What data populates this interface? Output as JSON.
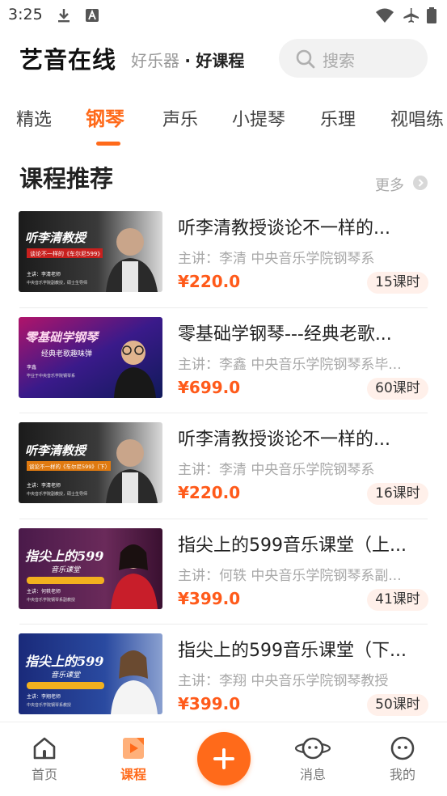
{
  "status_bar": {
    "time": "3:25"
  },
  "header": {
    "title": "艺音在线",
    "slogan_part1": "好乐器",
    "slogan_sep": "·",
    "slogan_part2": "好课程",
    "search_placeholder": "搜索"
  },
  "tabs": [
    {
      "label": "精选",
      "active": false
    },
    {
      "label": "钢琴",
      "active": true
    },
    {
      "label": "声乐",
      "active": false
    },
    {
      "label": "小提琴",
      "active": false
    },
    {
      "label": "乐理",
      "active": false
    },
    {
      "label": "视唱练",
      "active": false
    }
  ],
  "section": {
    "title": "课程推荐",
    "more_label": "更多"
  },
  "courses": [
    {
      "title": "听李清教授谈论不一样的...",
      "teacher": "主讲：李清 中央音乐学院钢琴系",
      "price": "¥220.0",
      "lessons": "15课时",
      "cover": {
        "headline": "听李清教授",
        "sub": "谈论不一样的《车尔尼599》",
        "name": "主讲：李清老师",
        "desc": "中央音乐学院副教授，硕士生导师"
      }
    },
    {
      "title": "零基础学钢琴---经典老歌...",
      "teacher": "主讲：李鑫 中央音乐学院钢琴系毕...",
      "price": "¥699.0",
      "lessons": "60课时",
      "cover": {
        "headline": "零基础学钢琴",
        "sub": "经典老歌趣味弹",
        "name": "李鑫",
        "desc": "毕业于中央音乐学院钢琴系"
      }
    },
    {
      "title": "听李清教授谈论不一样的...",
      "teacher": "主讲：李清 中央音乐学院钢琴系",
      "price": "¥220.0",
      "lessons": "16课时",
      "cover": {
        "headline": "听李清教授",
        "sub": "谈论不一样的《车尔尼599》（下）",
        "name": "主讲：李清老师",
        "desc": "中央音乐学院副教授，硕士生导师"
      }
    },
    {
      "title": "指尖上的599音乐课堂（上...",
      "teacher": "主讲：何轶 中央音乐学院钢琴系副...",
      "price": "¥399.0",
      "lessons": "41课时",
      "cover": {
        "headline": "指尖上的599",
        "sub": "音乐课堂",
        "name": "主讲：何轶老师",
        "desc": "中央音乐学院钢琴系副教授"
      }
    },
    {
      "title": "指尖上的599音乐课堂（下...",
      "teacher": "主讲：李翔 中央音乐学院钢琴教授",
      "price": "¥399.0",
      "lessons": "50课时",
      "cover": {
        "headline": "指尖上的599",
        "sub": "音乐课堂",
        "name": "主讲：李翔老师",
        "desc": "中央音乐学院钢琴系教授"
      }
    }
  ],
  "bottom_nav": [
    {
      "label": "首页",
      "icon": "home-icon",
      "active": false
    },
    {
      "label": "课程",
      "icon": "course-icon",
      "active": true
    },
    {
      "label": "",
      "icon": "plus-icon",
      "active": false
    },
    {
      "label": "消息",
      "icon": "message-icon",
      "active": false
    },
    {
      "label": "我的",
      "icon": "profile-icon",
      "active": false
    }
  ],
  "colors": {
    "accent": "#ff6a1a",
    "price": "#ff5a1a",
    "badge_bg": "#fff0ea",
    "muted": "#a8a8a8"
  }
}
